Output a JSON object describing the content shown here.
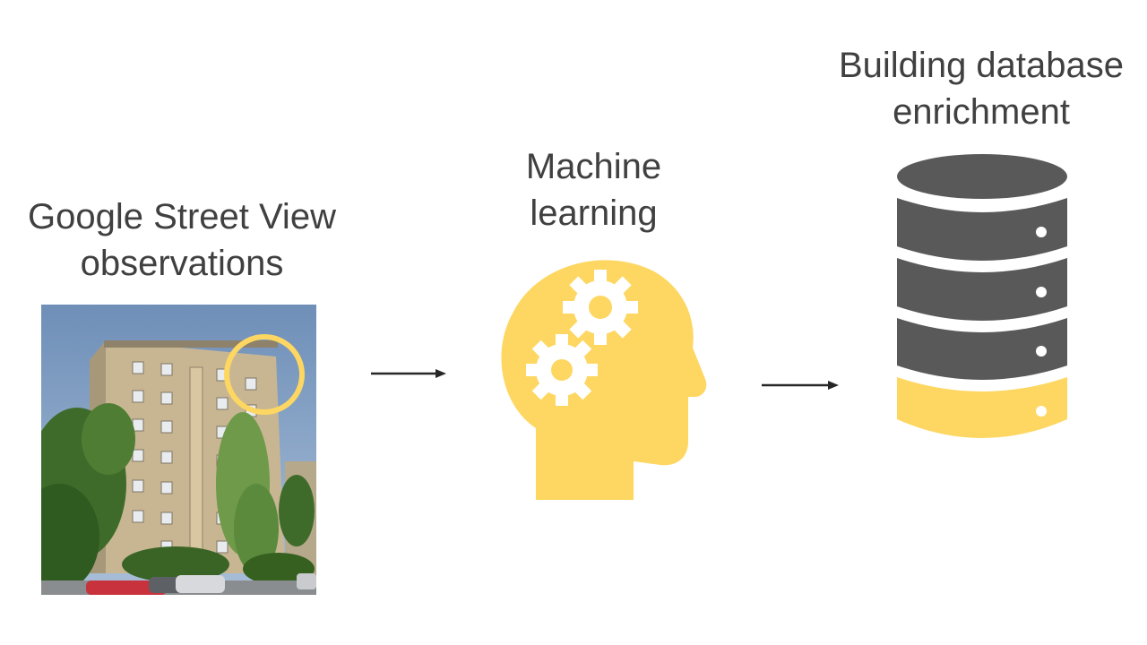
{
  "labels": {
    "street_view": [
      "Google Street View",
      "observations"
    ],
    "machine_learning": [
      "Machine",
      "learning"
    ],
    "database": [
      "Building database",
      "enrichment"
    ]
  },
  "colors": {
    "text": "#404040",
    "accent_yellow": "#FDD761",
    "database_gray": "#595959",
    "arrow": "#262626"
  },
  "icons": [
    "street-view-photo",
    "head-with-gears-icon",
    "database-icon",
    "arrow-right-icon"
  ]
}
